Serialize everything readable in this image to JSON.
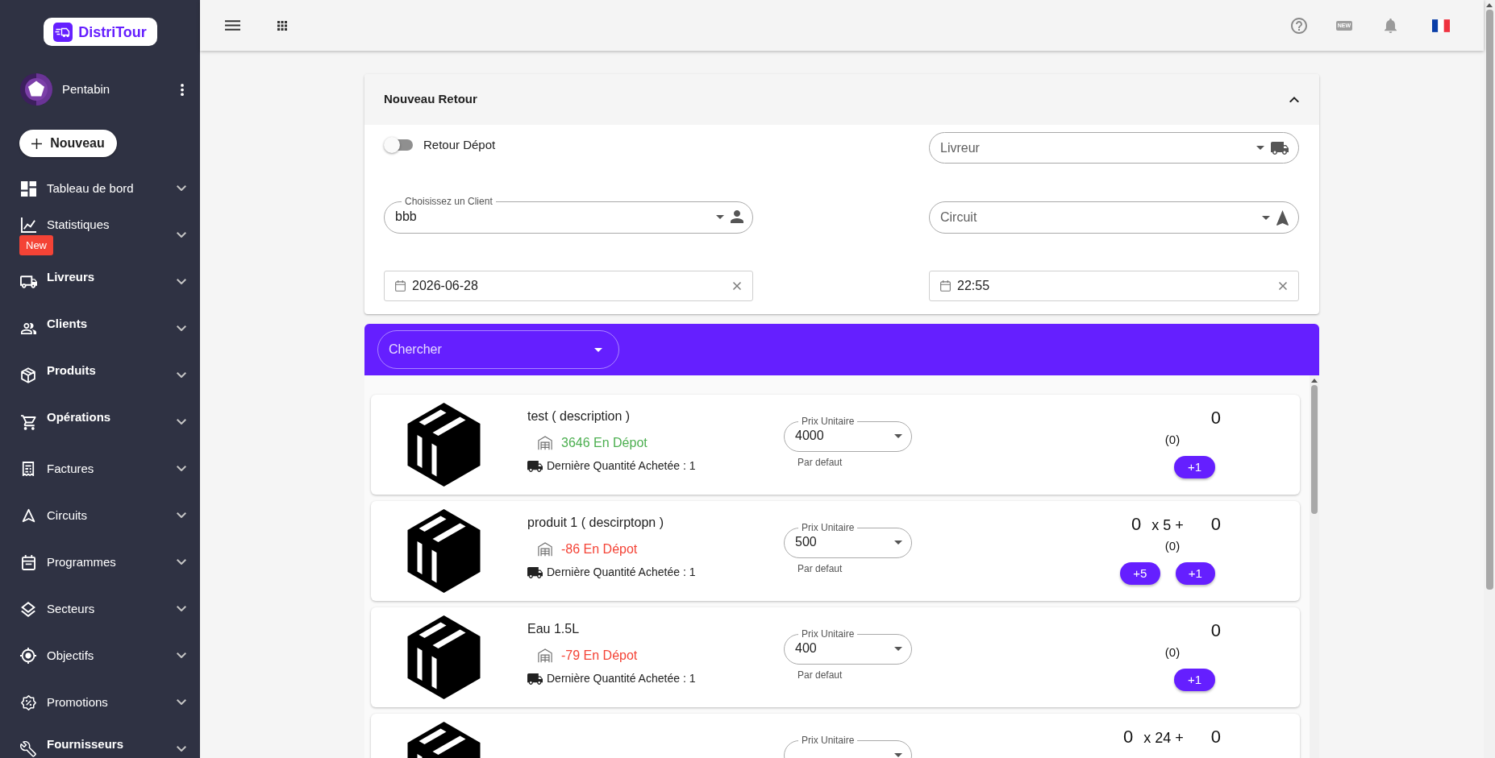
{
  "sidebar": {
    "logo": "DistriTour",
    "user": "Pentabin",
    "new_button": "Nouveau",
    "items": [
      {
        "label": "Tableau de bord",
        "bold": false,
        "expanded": false
      },
      {
        "label": "Statistiques",
        "bold": false,
        "expanded": false,
        "badge": "New"
      },
      {
        "label": "Livreurs",
        "bold": true,
        "expanded": false
      },
      {
        "label": "Clients",
        "bold": true,
        "expanded": false
      },
      {
        "label": "Produits",
        "bold": true,
        "expanded": false
      },
      {
        "label": "Opérations",
        "bold": true,
        "expanded": false
      },
      {
        "label": "Factures",
        "bold": false,
        "expanded": false
      },
      {
        "label": "Circuits",
        "bold": false,
        "expanded": false
      },
      {
        "label": "Programmes",
        "bold": false,
        "expanded": false
      },
      {
        "label": "Secteurs",
        "bold": false,
        "expanded": false
      },
      {
        "label": "Objectifs",
        "bold": false,
        "expanded": false
      },
      {
        "label": "Promotions",
        "bold": false,
        "expanded": false
      },
      {
        "label": "Fournisseurs",
        "bold": true,
        "expanded": false
      }
    ]
  },
  "topbar": {
    "news_badge": "NEW"
  },
  "form": {
    "title": "Nouveau Retour",
    "expanded": true,
    "retour_depot": {
      "label": "Retour Dépot",
      "on": false
    },
    "livreur": {
      "placeholder": "Livreur"
    },
    "client": {
      "label": "Choisissez un Client",
      "value": "bbb"
    },
    "circuit": {
      "placeholder": "Circuit"
    },
    "date": {
      "value": "2026-06-28"
    },
    "time": {
      "value": "22:55"
    }
  },
  "search": {
    "placeholder": "Chercher"
  },
  "products": [
    {
      "name": "test ( description )",
      "stock": {
        "text": "3646 En Dépot",
        "color": "#4caf50"
      },
      "last_purchase": "Dernière Quantité Achetée : 1",
      "price_label": "Prix Unitaire",
      "price": "4000",
      "price_hint": "Par defaut",
      "unit_count": "0",
      "total": "(0)",
      "buttons": [
        "+1"
      ]
    },
    {
      "name": "produit 1 ( descirptopn )",
      "stock": {
        "text": "-86 En Dépot",
        "color": "#f44336"
      },
      "last_purchase": "Dernière Quantité Achetée : 1",
      "price_label": "Prix Unitaire",
      "price": "500",
      "price_hint": "Par defaut",
      "pack_count": "0",
      "pack_label": "x 5 +",
      "unit_count": "0",
      "total": "(0)",
      "buttons": [
        "+5",
        "+1"
      ]
    },
    {
      "name": "Eau 1.5L",
      "stock": {
        "text": "-79 En Dépot",
        "color": "#f44336"
      },
      "last_purchase": "Dernière Quantité Achetée : 1",
      "price_label": "Prix Unitaire",
      "price": "400",
      "price_hint": "Par defaut",
      "unit_count": "0",
      "total": "(0)",
      "buttons": [
        "+1"
      ]
    },
    {
      "price_label": "Prix Unitaire",
      "pack_count": "0",
      "pack_label": "x 24 +",
      "unit_count": "0"
    }
  ]
}
